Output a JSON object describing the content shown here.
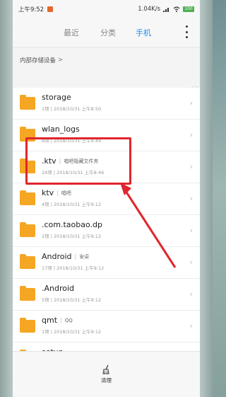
{
  "status_bar": {
    "time": "上午9:52",
    "speed": "1.04K/s",
    "battery": "100"
  },
  "tabs": [
    {
      "label": "最近",
      "active": false
    },
    {
      "label": "分类",
      "active": false
    },
    {
      "label": "手机",
      "active": true
    }
  ],
  "breadcrumb": {
    "label": "内部存储设备",
    "chevron": ">"
  },
  "files": [
    {
      "name": "storage",
      "tag": "",
      "meta": "1项 | 2018/10/31 上午8:50"
    },
    {
      "name": "wlan_logs",
      "tag": "",
      "meta": "8项 | 2018/10/31 上午9:49"
    },
    {
      "name": ".ktv",
      "tag": "唱吧隐藏文件夹",
      "meta": "24项 | 2018/10/31 上午8:46"
    },
    {
      "name": "ktv",
      "tag": "唱吧",
      "meta": "4项 | 2018/10/31 上午9:12"
    },
    {
      "name": ".com.taobao.dp",
      "tag": "",
      "meta": "2项 | 2018/10/31 上午9:12"
    },
    {
      "name": "Android",
      "tag": "安卓",
      "meta": "17项 | 2018/10/31 上午9:12"
    },
    {
      "name": ".Android",
      "tag": "",
      "meta": "5项 | 2018/10/31 上午9:12"
    },
    {
      "name": "qmt",
      "tag": "QQ",
      "meta": "1项 | 2018/10/31 上午9:12"
    },
    {
      "name": "setup",
      "tag": "",
      "meta": ""
    }
  ],
  "bottom_bar": {
    "clean_label": "清理",
    "clean_icon": "broom-icon"
  },
  "colors": {
    "accent": "#1f8ef1",
    "folder": "#f5a623",
    "annotation": "#e0262d"
  }
}
